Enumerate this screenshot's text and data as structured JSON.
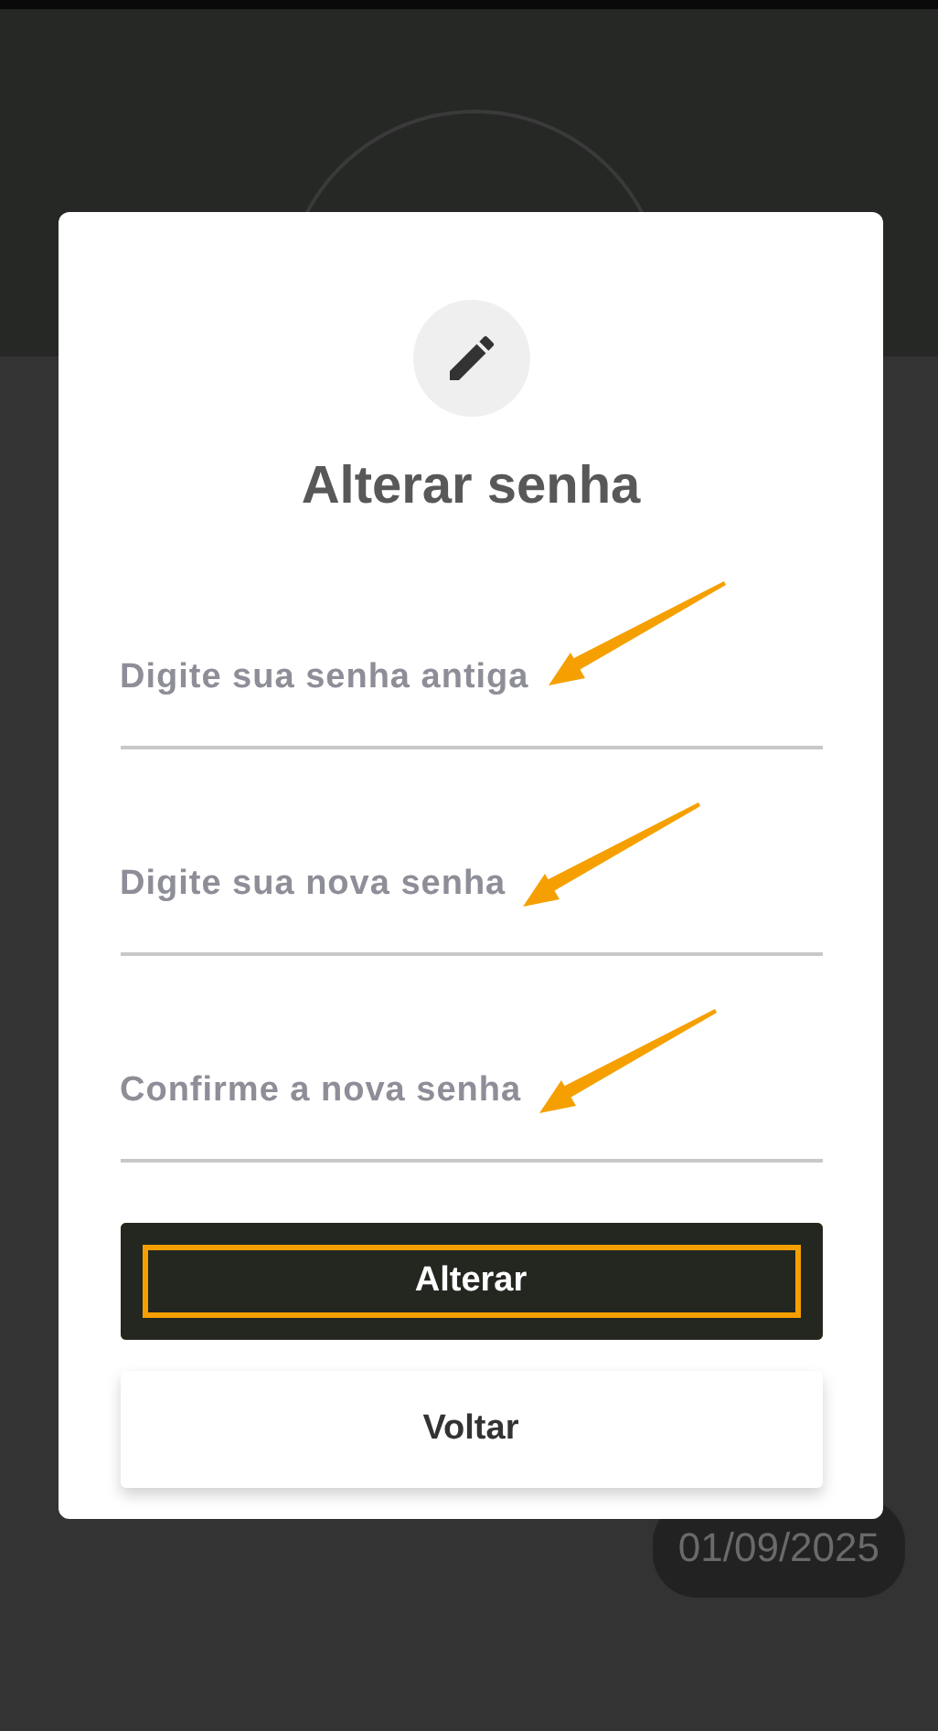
{
  "background": {
    "date_badge": "01/09/2025"
  },
  "dialog": {
    "title": "Alterar senha",
    "fields": [
      {
        "placeholder": "Digite sua senha antiga",
        "marked": true
      },
      {
        "placeholder": "Digite sua nova senha",
        "marked": true
      },
      {
        "placeholder": "Confirme a nova senha",
        "marked": true
      }
    ],
    "buttons": [
      {
        "label": "Alterar",
        "kind": "primary",
        "highlighted": true
      },
      {
        "label": "Voltar",
        "kind": "secondary",
        "highlighted": false
      }
    ]
  }
}
